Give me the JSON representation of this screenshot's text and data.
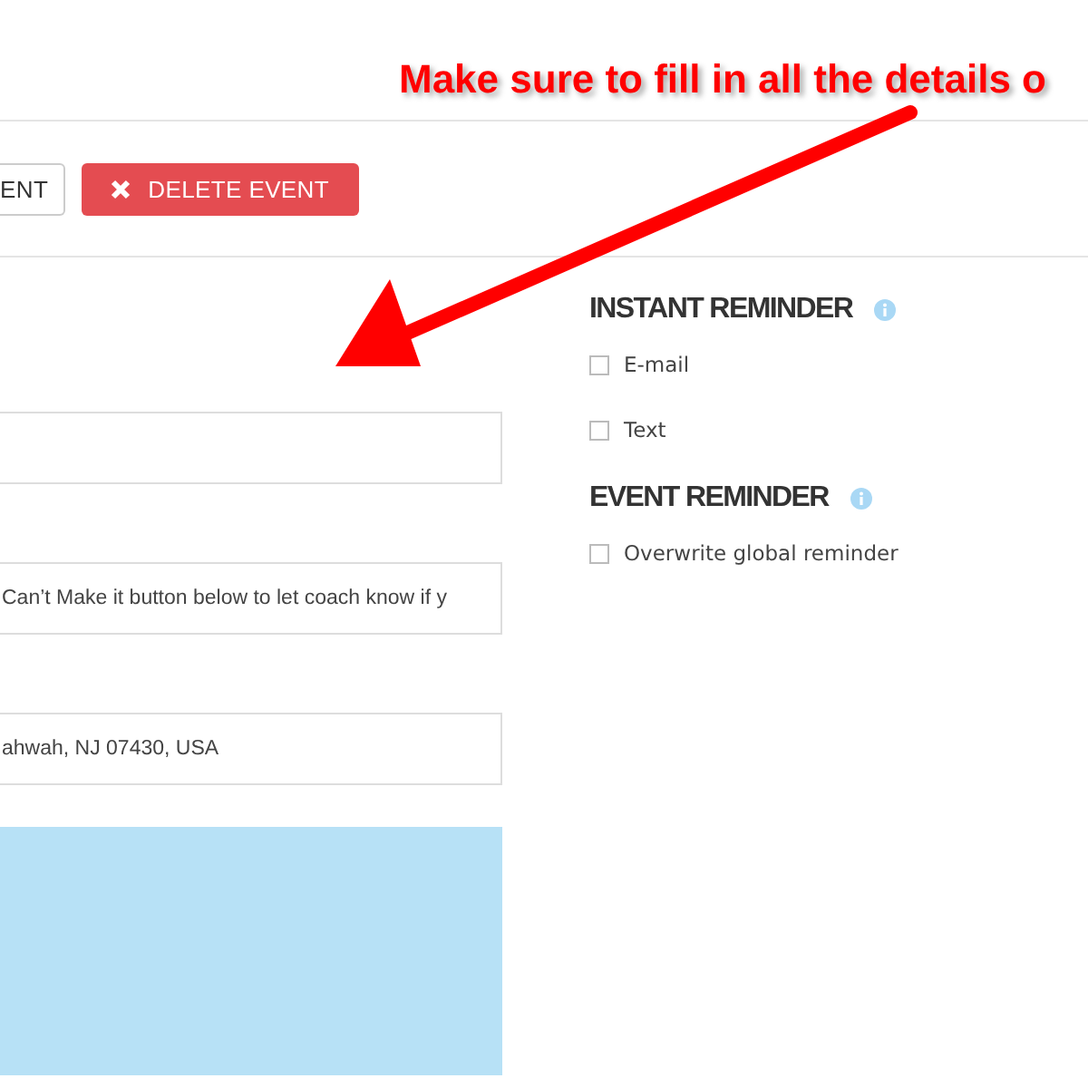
{
  "annotation": {
    "text": "Make sure to fill in all the details o"
  },
  "buttons": [
    {
      "label": "ENT",
      "kind": "outline"
    },
    {
      "label": "DELETE EVENT",
      "kind": "danger"
    }
  ],
  "fields": [
    {
      "kind": "blank"
    },
    {
      "kind": "filled",
      "value": "Can’t Make it button below to let coach know if y"
    },
    {
      "kind": "filled",
      "value": "ahwah, NJ 07430, USA"
    }
  ],
  "sections": [
    {
      "title": "INSTANT REMINDER",
      "options": [
        {
          "label": "E-mail",
          "checked": false
        },
        {
          "label": "Text",
          "checked": false
        }
      ]
    },
    {
      "title": "EVENT REMINDER",
      "options": [
        {
          "label": "Overwrite global reminder",
          "checked": false
        }
      ]
    }
  ]
}
